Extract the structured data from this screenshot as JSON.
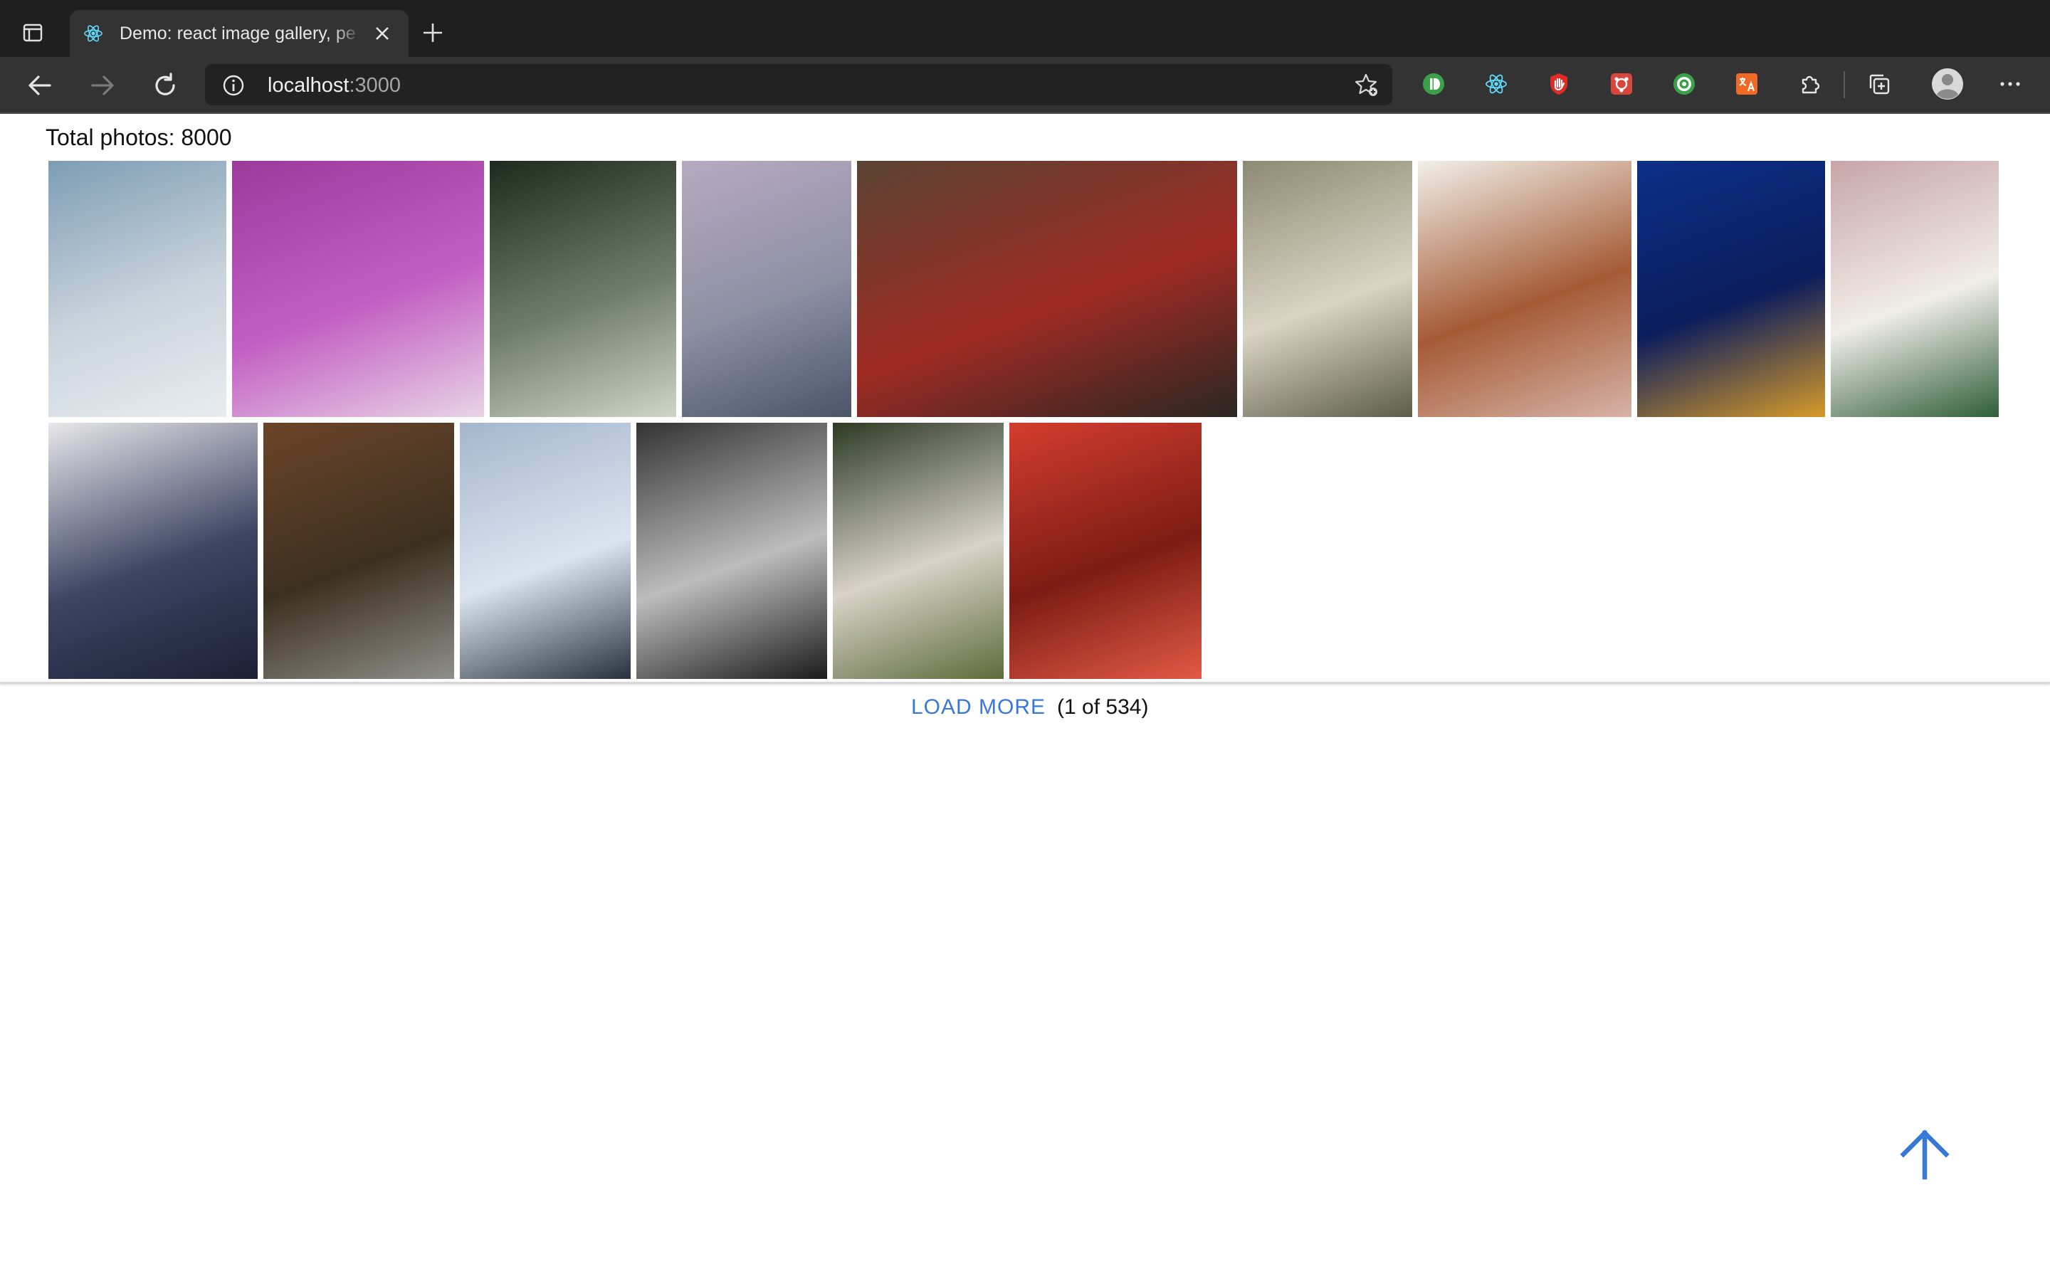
{
  "browser": {
    "tab_title": "Demo: react image gallery, pe",
    "url_host": "localhost",
    "url_port": ":3000",
    "extensions": [
      "ublock-icon",
      "react-devtools-icon",
      "hand-icon",
      "redux-icon",
      "target-icon",
      "translate-icon",
      "puzzle-icon"
    ]
  },
  "page": {
    "total_label": "Total photos: 8000",
    "load_more_label": "LOAD MORE",
    "page_count": "(1 of 534)",
    "accent": "#3878d6"
  },
  "gallery": {
    "row1": [
      {
        "name": "woman-lying-photo",
        "colors": [
          "#7d9db4",
          "#c9d3dc",
          "#e8ecef"
        ]
      },
      {
        "name": "purple-building-photo",
        "colors": [
          "#9c3a9c",
          "#c35fc3",
          "#e8d4e6"
        ]
      },
      {
        "name": "ivy-leaves-photo",
        "colors": [
          "#1e2a1d",
          "#6f7d68",
          "#cfd6c8"
        ]
      },
      {
        "name": "sea-dusk-photo",
        "colors": [
          "#b7a9c2",
          "#8d8fa3",
          "#4a5567"
        ]
      },
      {
        "name": "neon-cafe-photo",
        "colors": [
          "#5a4332",
          "#9f2a24",
          "#2a2722"
        ]
      },
      {
        "name": "stone-carving-photo",
        "colors": [
          "#8d8a72",
          "#d9d5c4",
          "#5d5b4a"
        ]
      },
      {
        "name": "circle-art-photo",
        "colors": [
          "#f1efe9",
          "#a55a35",
          "#d7b3a7"
        ]
      },
      {
        "name": "flowers-blue-photo",
        "colors": [
          "#0c2f88",
          "#0b1d5c",
          "#d69a2a"
        ]
      },
      {
        "name": "woman-bouquet-photo",
        "colors": [
          "#c7a5a8",
          "#f0ede9",
          "#2f5e37"
        ]
      }
    ],
    "row2": [
      {
        "name": "polaroid-feet-photo",
        "colors": [
          "#e8e7ea",
          "#3d4463",
          "#1c2036"
        ]
      },
      {
        "name": "forest-road-photo",
        "colors": [
          "#6b4428",
          "#3d3020",
          "#8e8f8a"
        ]
      },
      {
        "name": "hand-glass-photo",
        "colors": [
          "#a4b6cc",
          "#dbe4ef",
          "#28303d"
        ]
      },
      {
        "name": "tower-bridge-photo",
        "colors": [
          "#333333",
          "#bdbdbd",
          "#1b1b1b"
        ]
      },
      {
        "name": "woman-flowers-photo",
        "colors": [
          "#2d3a24",
          "#d8d3c7",
          "#5e6b3c"
        ]
      },
      {
        "name": "tree-shadow-photo",
        "colors": [
          "#d43d2f",
          "#7c1c14",
          "#e25a45"
        ]
      }
    ]
  }
}
